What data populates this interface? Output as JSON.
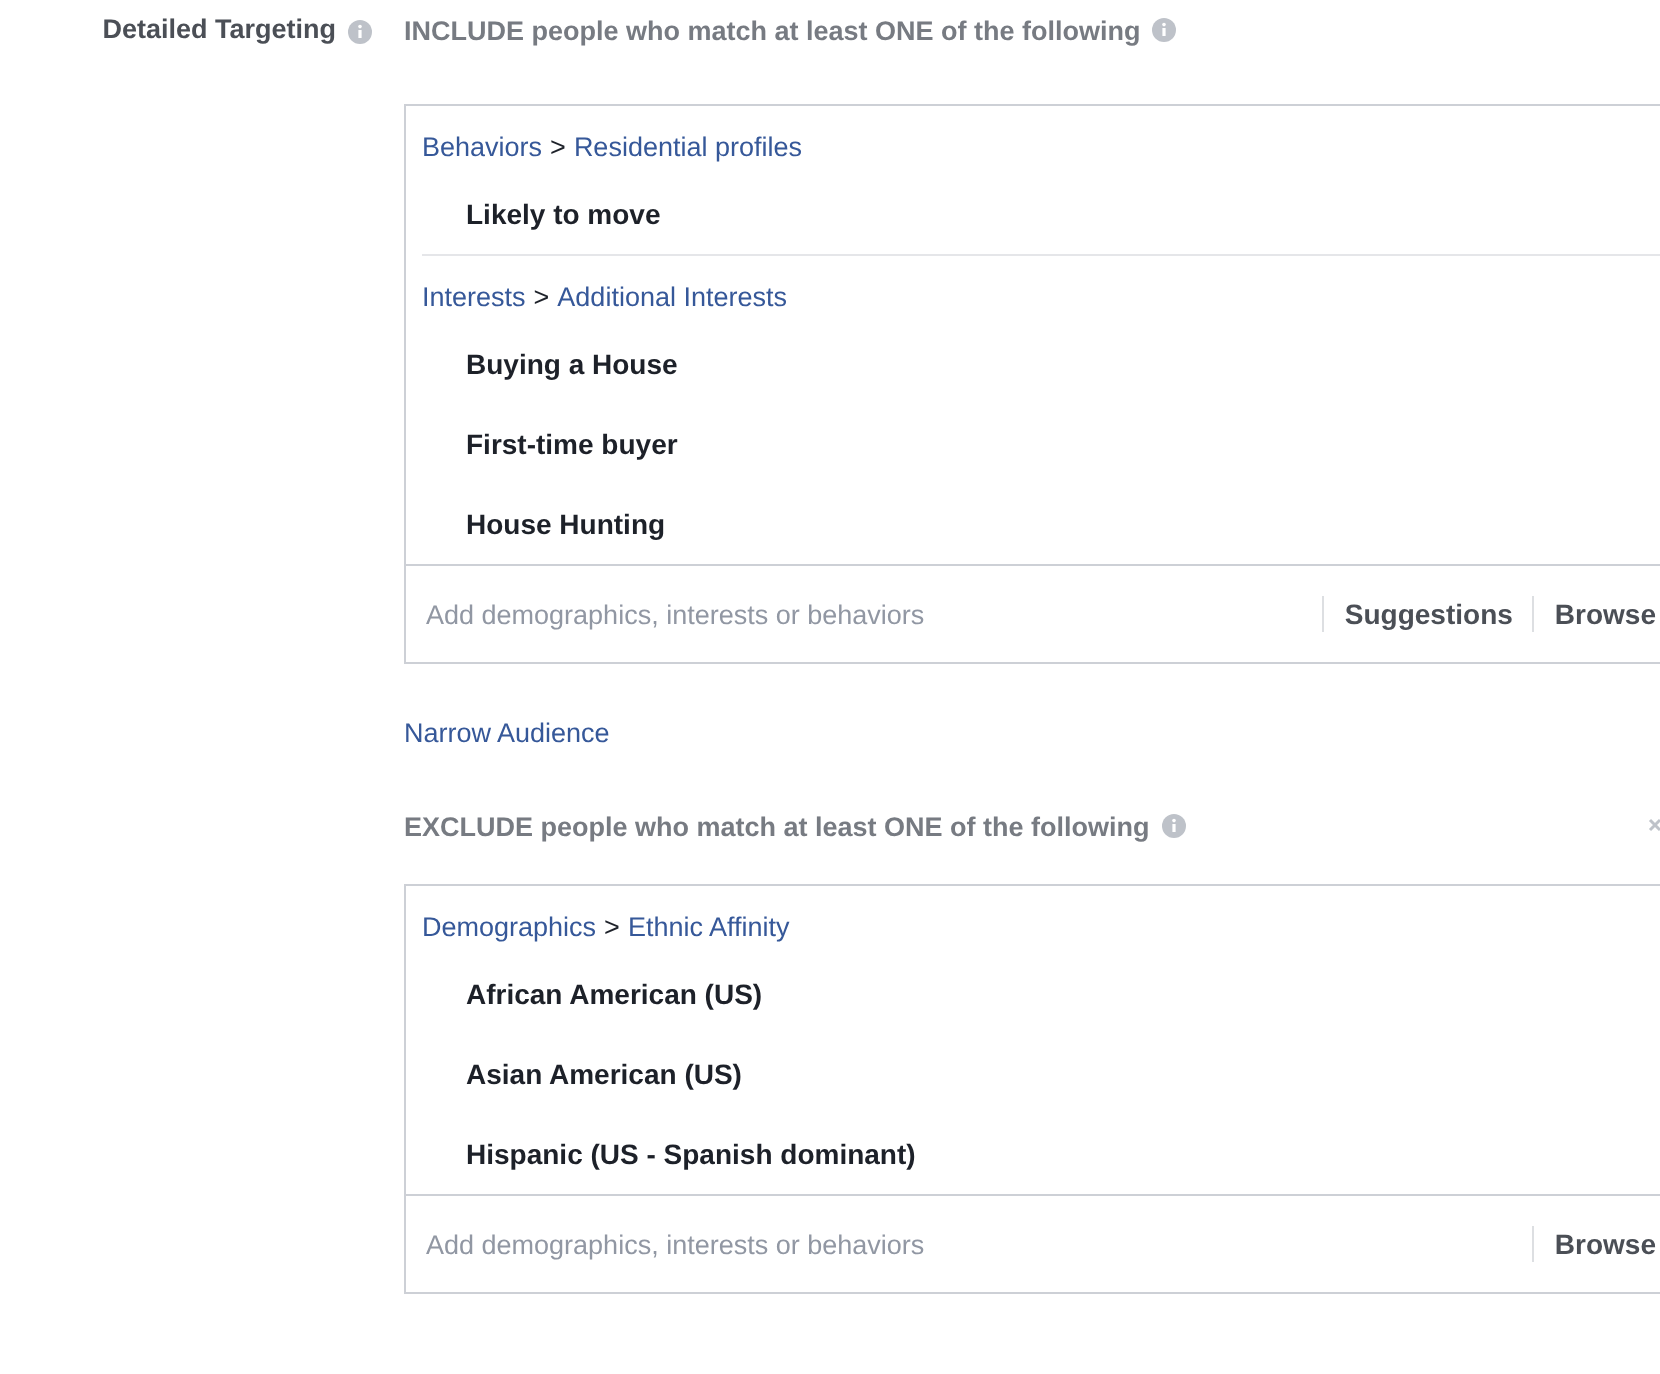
{
  "label": "Detailed Targeting",
  "include": {
    "heading": "INCLUDE people who match at least ONE of the following",
    "groups": [
      {
        "category": "Behaviors",
        "separator": ">",
        "subcategory": "Residential profiles",
        "items": [
          "Likely to move"
        ]
      },
      {
        "category": "Interests",
        "separator": ">",
        "subcategory": "Additional Interests",
        "items": [
          "Buying a House",
          "First-time buyer",
          "House Hunting"
        ]
      }
    ],
    "placeholder": "Add demographics, interests or behaviors",
    "actions": [
      "Suggestions",
      "Browse"
    ]
  },
  "narrow_link": "Narrow Audience",
  "exclude": {
    "heading": "EXCLUDE people who match at least ONE of the following",
    "groups": [
      {
        "category": "Demographics",
        "separator": ">",
        "subcategory": "Ethnic Affinity",
        "items": [
          "African American (US)",
          "Asian American (US)",
          "Hispanic (US - Spanish dominant)"
        ]
      }
    ],
    "placeholder": "Add demographics, interests or behaviors",
    "actions": [
      "Browse"
    ]
  }
}
